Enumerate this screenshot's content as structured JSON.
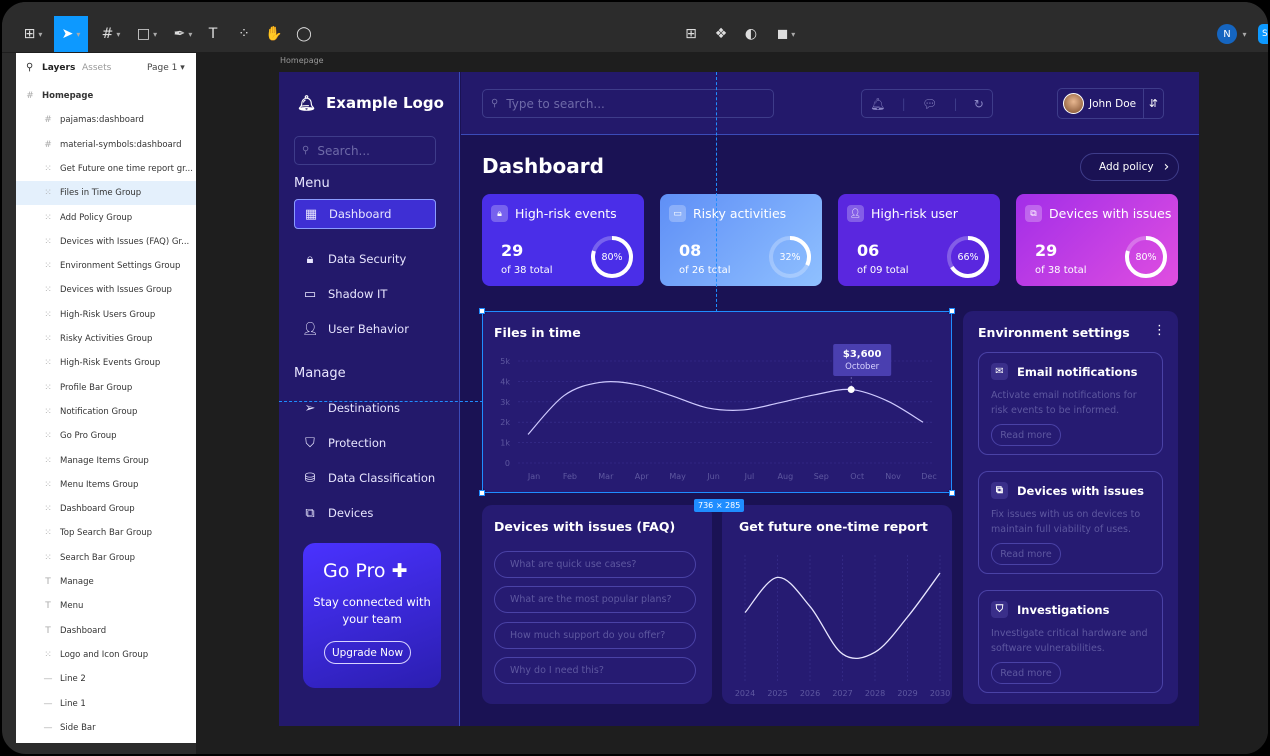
{
  "figma": {
    "tools": [
      "frame-tool",
      "move-tool",
      "region-tool",
      "shape-tool",
      "pen-tool",
      "text-tool",
      "resources-tool",
      "hand-tool",
      "comment-tool"
    ],
    "user_initial": "N",
    "share_label": "S",
    "layers_tab": "Layers",
    "assets_tab": "Assets",
    "page_label": "Page 1",
    "frame_label": "Homepage",
    "dimension_badge": "736 × 285",
    "layers": [
      {
        "name": "Homepage",
        "type": "frame"
      },
      {
        "name": "pajamas:dashboard",
        "type": "frame"
      },
      {
        "name": "material-symbols:dashboard",
        "type": "frame"
      },
      {
        "name": "Get Future one time report gr...",
        "type": "group"
      },
      {
        "name": "Files in Time Group",
        "type": "group"
      },
      {
        "name": "Add Policy Group",
        "type": "group"
      },
      {
        "name": "Devices with Issues (FAQ) Gr...",
        "type": "group"
      },
      {
        "name": "Environment Settings Group",
        "type": "group"
      },
      {
        "name": "Devices with Issues Group",
        "type": "group"
      },
      {
        "name": "High-Risk Users Group",
        "type": "group"
      },
      {
        "name": "Risky Activities Group",
        "type": "group"
      },
      {
        "name": "High-Risk Events Group",
        "type": "group"
      },
      {
        "name": "Profile Bar Group",
        "type": "group"
      },
      {
        "name": "Notification Group",
        "type": "group"
      },
      {
        "name": "Go Pro Group",
        "type": "group"
      },
      {
        "name": "Manage Items Group",
        "type": "group"
      },
      {
        "name": "Menu Items Group",
        "type": "group"
      },
      {
        "name": "Dashboard Group",
        "type": "group"
      },
      {
        "name": "Top Search Bar Group",
        "type": "group"
      },
      {
        "name": "Search Bar Group",
        "type": "group"
      },
      {
        "name": "Manage",
        "type": "text"
      },
      {
        "name": "Menu",
        "type": "text"
      },
      {
        "name": "Dashboard",
        "type": "text"
      },
      {
        "name": "Logo and Icon Group",
        "type": "group"
      },
      {
        "name": "Line 2",
        "type": "line"
      },
      {
        "name": "Line 1",
        "type": "line"
      },
      {
        "name": "Side Bar",
        "type": "line"
      }
    ]
  },
  "app": {
    "logo": "Example Logo",
    "sidebar_search": "Search...",
    "menu_heading": "Menu",
    "manage_heading": "Manage",
    "menu_items": [
      "Dashboard",
      "Data Security",
      "Shadow IT",
      "User Behavior"
    ],
    "manage_items": [
      "Destinations",
      "Protection",
      "Data Classification",
      "Devices"
    ],
    "gopro": {
      "title": "Go Pro",
      "text": "Stay connected with your team",
      "button": "Upgrade Now"
    },
    "top_search": "Type to search...",
    "user_name": "John Doe",
    "title": "Dashboard",
    "add_policy": "Add policy",
    "stats": [
      {
        "label": "High-risk events",
        "value": "29",
        "sub": "of 38 total",
        "pct": "80%",
        "fraction": 0.8,
        "color": "#4a2ee8"
      },
      {
        "label": "Risky activities",
        "value": "08",
        "sub": "of 26 total",
        "pct": "32%",
        "fraction": 0.32,
        "color": "#5b8cf5"
      },
      {
        "label": "High-risk user",
        "value": "06",
        "sub": "of 09 total",
        "pct": "66%",
        "fraction": 0.66,
        "color": "#5a27df"
      },
      {
        "label": "Devices with issues",
        "value": "29",
        "sub": "of 38 total",
        "pct": "80%",
        "fraction": 0.8,
        "color": "#c22ee0"
      }
    ],
    "files_title": "Files in time",
    "tooltip_value": "$3,600",
    "tooltip_label": "October",
    "faq_title": "Devices with issues (FAQ)",
    "faq": [
      "What are quick use cases?",
      "What are the most popular plans?",
      "How much support  do you offer?",
      "Why do I need this?"
    ],
    "report_title": "Get future one-time report",
    "env_title": "Environment settings",
    "env_cards": [
      {
        "title": "Email notifications",
        "desc": "Activate email notifications for risk events to be informed.",
        "link": "Read more"
      },
      {
        "title": "Devices with issues",
        "desc": "Fix issues with us on devices to maintain full viability of uses.",
        "link": "Read more"
      },
      {
        "title": "Investigations",
        "desc": "Investigate critical hardware and software vulnerabilities.",
        "link": "Read more"
      }
    ]
  },
  "chart_data": [
    {
      "type": "line",
      "title": "Files in time",
      "categories": [
        "Jan",
        "Feb",
        "Mar",
        "Apr",
        "May",
        "Jun",
        "Jul",
        "Aug",
        "Sep",
        "Oct",
        "Nov",
        "Dec"
      ],
      "yticks": [
        "5k",
        "4k",
        "3k",
        "2k",
        "1k",
        "0"
      ],
      "ylim": [
        0,
        5000
      ],
      "values": [
        1400,
        3300,
        3950,
        3850,
        3300,
        2700,
        2600,
        2950,
        3350,
        3600,
        3050,
        2000
      ],
      "annotation": {
        "x": "Oct",
        "value": "$3,600",
        "label": "October"
      }
    },
    {
      "type": "line",
      "title": "Get future one-time report",
      "categories": [
        "2024",
        "2025",
        "2026",
        "2027",
        "2028",
        "2029",
        "2030"
      ],
      "values": [
        0.55,
        0.95,
        0.62,
        0.08,
        0.1,
        0.5,
        1.0
      ]
    }
  ]
}
